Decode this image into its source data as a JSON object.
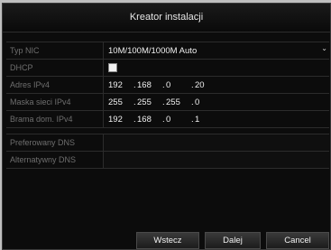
{
  "window": {
    "title": "Kreator instalacji"
  },
  "form": {
    "nic": {
      "label": "Typ NIC",
      "value": "10M/100M/1000M Auto"
    },
    "dhcp": {
      "label": "DHCP",
      "checked": false
    },
    "ipv4": {
      "label": "Adres IPv4",
      "octets": [
        "192",
        "168",
        "0",
        "20"
      ]
    },
    "mask": {
      "label": "Maska sieci IPv4",
      "octets": [
        "255",
        "255",
        "255",
        "0"
      ]
    },
    "gateway": {
      "label": "Brama dom. IPv4",
      "octets": [
        "192",
        "168",
        "0",
        "1"
      ]
    },
    "dns_pref": {
      "label": "Preferowany DNS",
      "value": ""
    },
    "dns_alt": {
      "label": "Alternatywny DNS",
      "value": ""
    }
  },
  "buttons": {
    "back": "Wstecz",
    "next": "Dalej",
    "cancel": "Cancel"
  }
}
